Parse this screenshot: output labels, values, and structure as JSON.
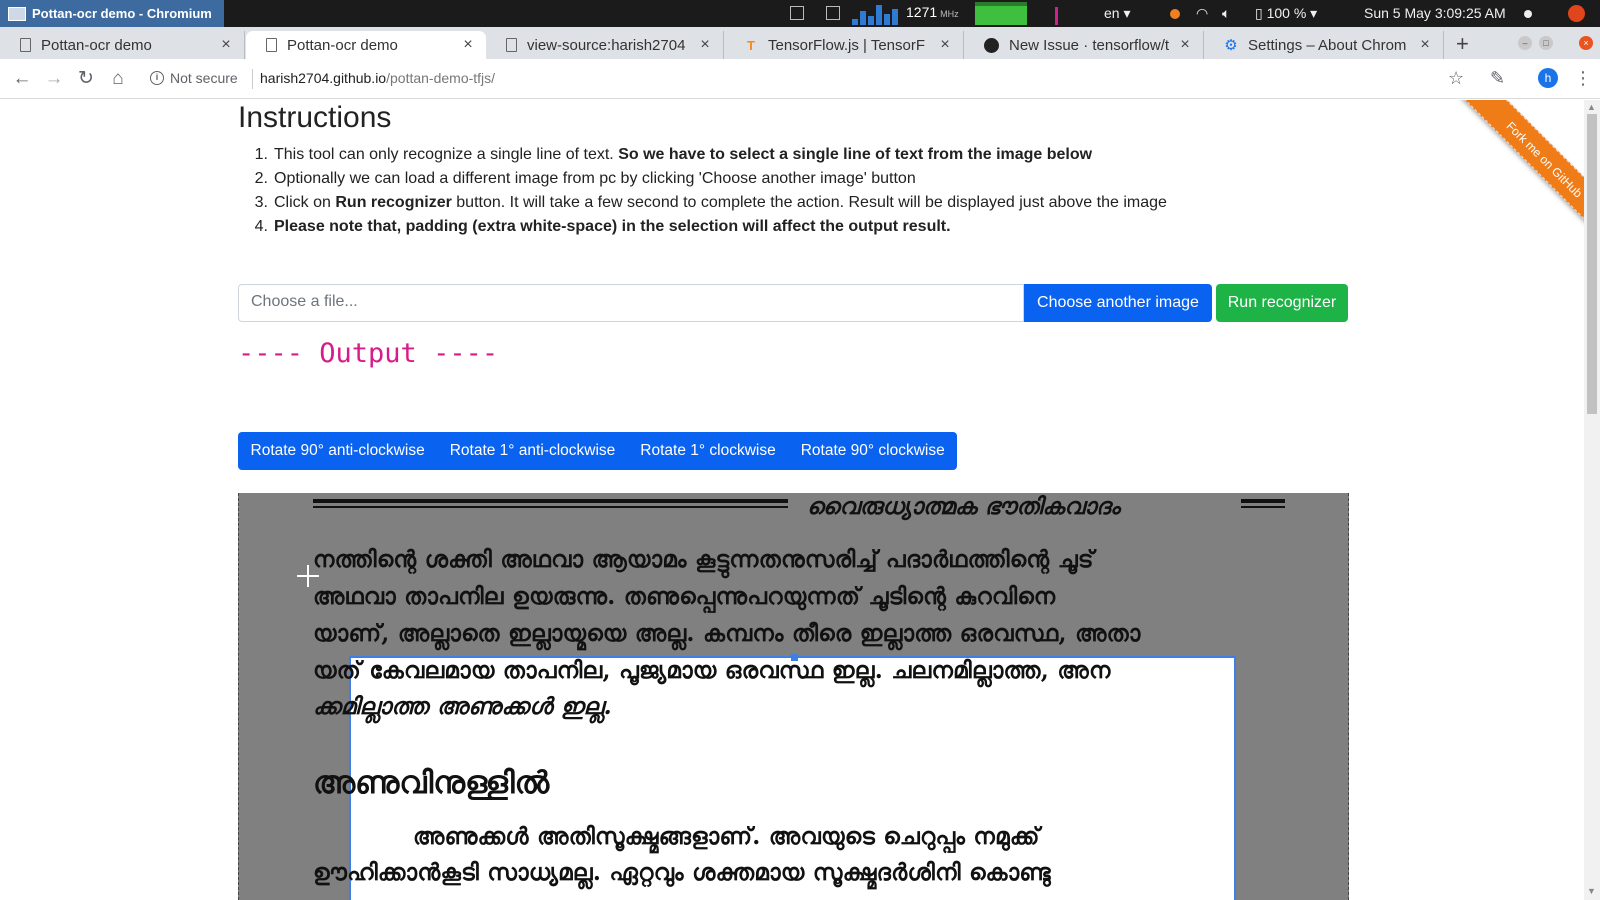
{
  "os": {
    "window_title": "Pottan-ocr demo - Chromium",
    "cpu_freq": "1271",
    "cpu_unit": "MHz",
    "keyboard_layout": "en",
    "battery": "100 %",
    "clock": "Sun 5 May  3:09:25 AM"
  },
  "browser": {
    "tabs": [
      {
        "label": "Pottan-ocr demo",
        "icon": "page-icon"
      },
      {
        "label": "Pottan-ocr demo",
        "icon": "page-icon"
      },
      {
        "label": "view-source:harish2704",
        "icon": "page-icon"
      },
      {
        "label": "TensorFlow.js | TensorF",
        "icon": "tensorflow-icon"
      },
      {
        "label": "New Issue · tensorflow/t",
        "icon": "github-icon"
      },
      {
        "label": "Settings – About Chrom",
        "icon": "settings-gear-icon"
      }
    ],
    "active_tab_index": 1,
    "security_label": "Not secure",
    "url_host": "harish2704.github.io",
    "url_path": "/pottan-demo-tfjs/",
    "avatar_letter": "h"
  },
  "page": {
    "heading": "Instructions",
    "steps": [
      {
        "num": "1.",
        "text": "This tool can only recognize a single line of text. ",
        "bold": "So we have to select a single line of text from the image below",
        "after": ""
      },
      {
        "num": "2.",
        "text": "Optionally we can load a different image from pc by clicking 'Choose another image' button",
        "bold": "",
        "after": ""
      },
      {
        "num": "3.",
        "text": "Click on ",
        "bold": "Run recognizer",
        "after": " button. It will take a few second to complete the action. Result will be displayed just above the image"
      },
      {
        "num": "4.",
        "text": "",
        "bold": "Please note that, padding (extra white-space) in the selection will affect the output result.",
        "after": ""
      }
    ],
    "file_placeholder": "Choose a file...",
    "choose_button": "Choose another image",
    "run_button": "Run recognizer",
    "output_label": "---- Output ----",
    "rotate_buttons": [
      "Rotate 90° anti-clockwise",
      "Rotate 1° anti-clockwise",
      "Rotate 1° clockwise",
      "Rotate 90° clockwise"
    ],
    "ribbon": "Fork me on GitHub"
  },
  "scan": {
    "header": "വൈരുധ്യാത്മക ഭൗതികവാദം",
    "lines": [
      "നത്തിന്റെ ശക്തി അഥവാ ആയാമം കൂട്ടുന്നതനുസരിച്ച് പദാർഥത്തിന്റെ ചൂട്",
      "അഥവാ താപനില ഉയരുന്നു. തണുപ്പെന്നുപറയുന്നത് ചൂടിന്റെ കുറവിനെ",
      "യാണ്, അല്ലാതെ ഇല്ലായ്മയെ അല്ല. കമ്പനം തീരെ ഇല്ലാത്ത ഒരവസ്ഥ, അതാ",
      "യത് കേവലമായ താപനില, പൂജ്യമായ ഒരവസ്ഥ ഇല്ല. ചലനമില്ലാത്ത, അന",
      "ക്കമില്ലാത്ത അണുക്കൾ ഇല്ല."
    ],
    "heading": "അണുവിനുള്ളിൽ",
    "lines2": [
      "അണുക്കൾ അതിസൂക്ഷ്മങ്ങളാണ്. അവയുടെ ചെറുപ്പം നമുക്ക്",
      "ഊഹിക്കാൻകൂടി സാധ്യമല്ല. ഏറ്റവും ശക്തമായ സൂക്ഷ്മദർശിനി കൊണ്ടു"
    ]
  }
}
